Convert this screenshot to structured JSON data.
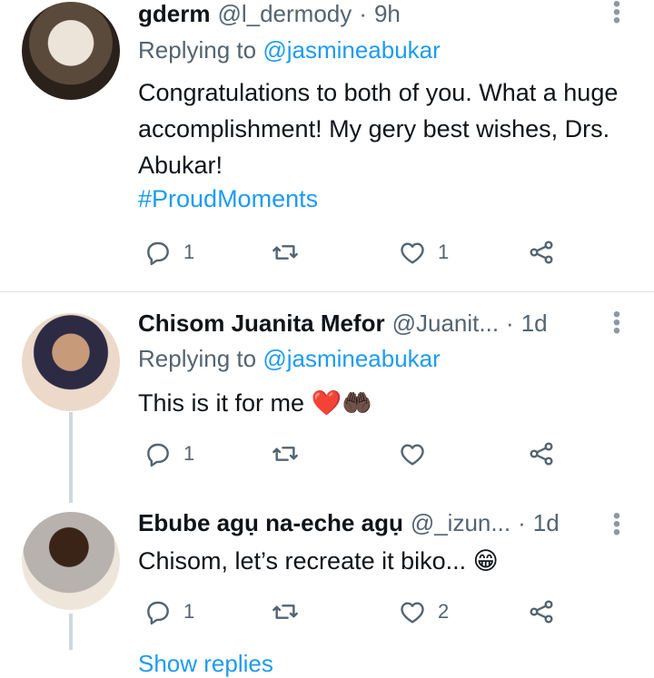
{
  "tweets": [
    {
      "name": "gderm",
      "handle": "@l_dermody",
      "dot": "·",
      "time": "9h",
      "replying_prefix": "Replying to",
      "replying_to": "@jasmineabukar",
      "text": "Congratulations to both of you. What a huge accomplishment! My gery best wishes, Drs. Abukar!",
      "hashtag": "#ProudMoments",
      "replies": "1",
      "retweets": "",
      "likes": "1"
    },
    {
      "name": "Chisom Juanita Mefor",
      "handle": "@Juanit...",
      "dot": "·",
      "time": "1d",
      "replying_prefix": "Replying to",
      "replying_to": "@jasmineabukar",
      "text": "This is it for me",
      "emoji": "❤️🤲🏿",
      "replies": "1",
      "retweets": "",
      "likes": ""
    },
    {
      "name": "Ebube agụ na-eche agụ",
      "handle": "@_izun...",
      "dot": "·",
      "time": "1d",
      "text": "Chisom, let’s recreate it biko...",
      "emoji": "😁",
      "replies": "1",
      "retweets": "",
      "likes": "2"
    }
  ],
  "show_replies": "Show replies",
  "colors": {
    "link": "#1d9bf0",
    "muted": "#536471",
    "text": "#0f1419"
  },
  "icons": [
    "reply-icon",
    "retweet-icon",
    "like-icon",
    "share-icon",
    "more-icon"
  ]
}
